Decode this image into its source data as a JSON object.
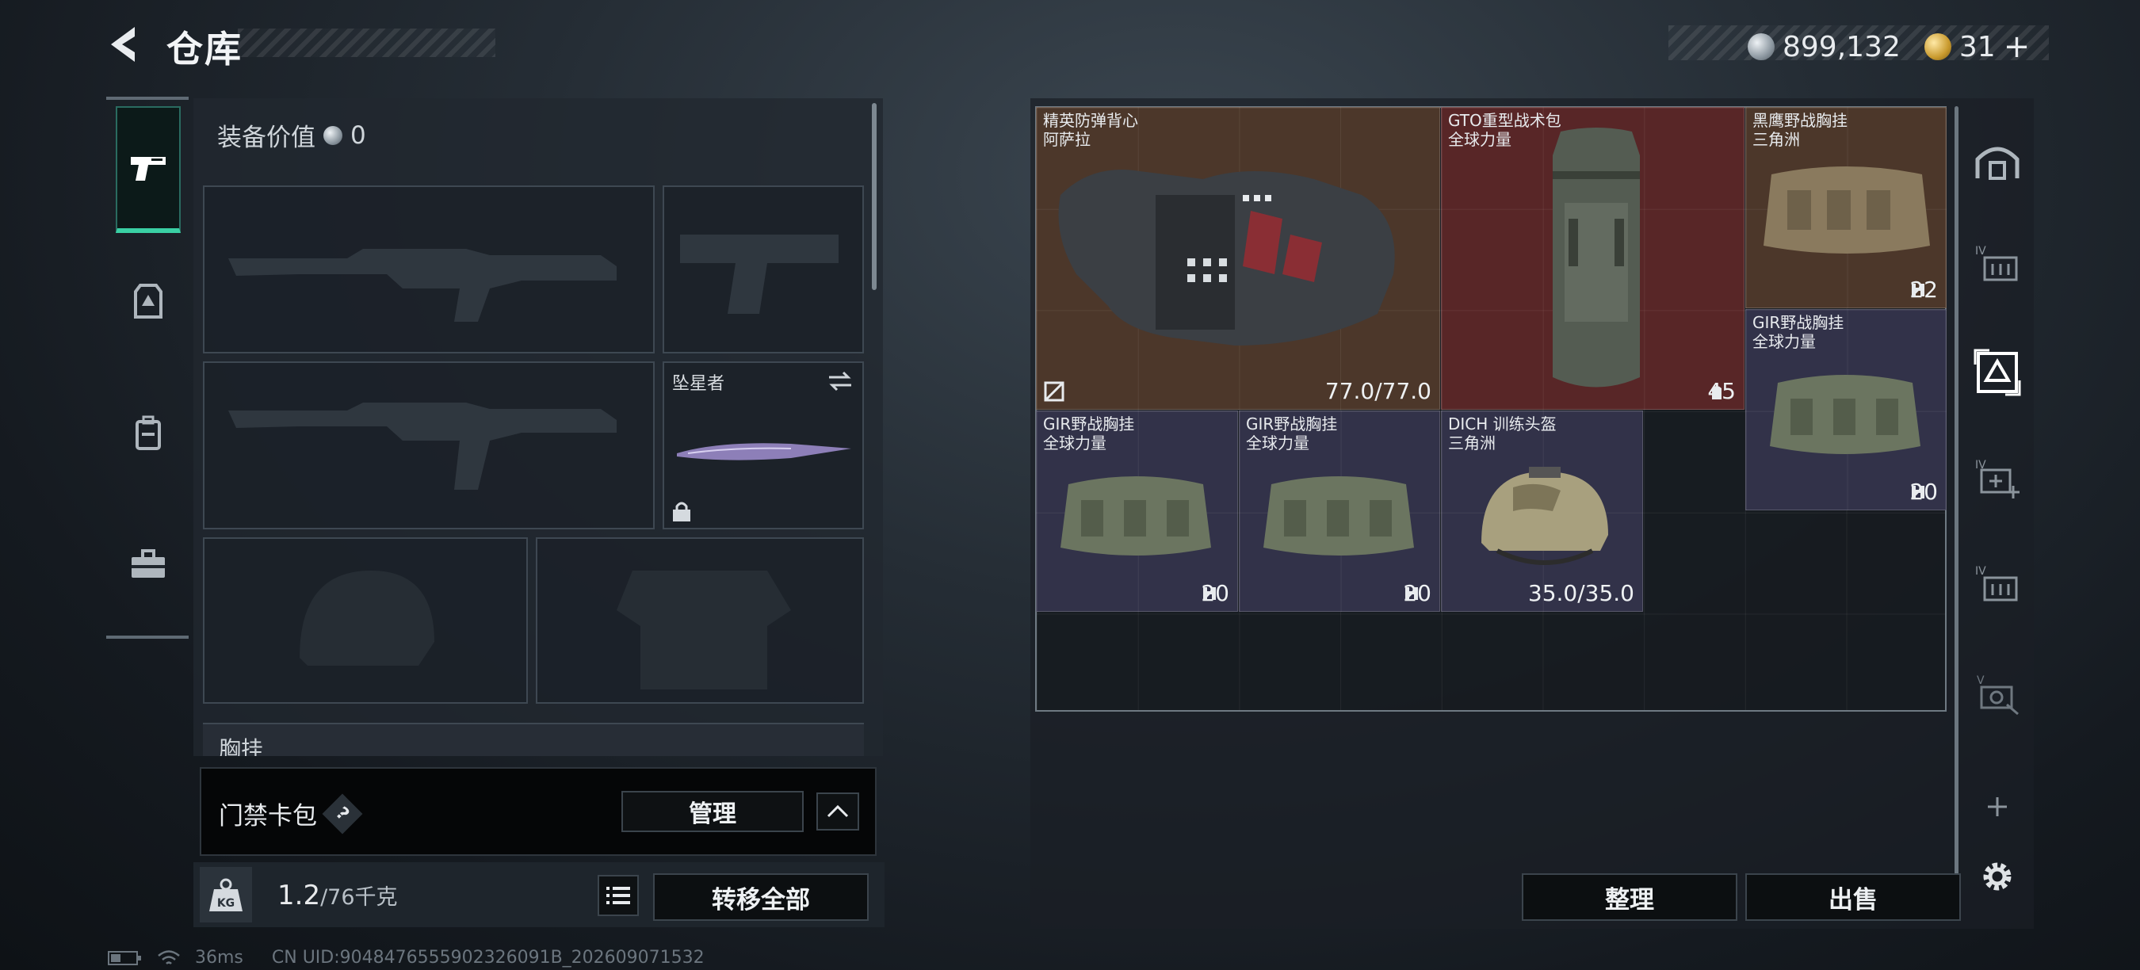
{
  "header": {
    "title": "仓库"
  },
  "currency": {
    "coins": "899,132",
    "tickets": "31",
    "add_symbol": "+"
  },
  "equipment": {
    "value_label": "装备价值",
    "value": "0",
    "melee_slot_name": "坠星者",
    "chest_rig_label": "胸挂"
  },
  "keycard": {
    "label": "门禁卡包",
    "help": "?",
    "manage": "管理"
  },
  "weight": {
    "current": "1.2",
    "max": "/76千克"
  },
  "actions": {
    "transfer_all": "转移全部",
    "sort": "整理",
    "sell": "出售"
  },
  "stash_items": [
    {
      "name": "精英防弹背心",
      "sub": "阿萨拉",
      "stat": "77.0/77.0",
      "rarity": "brown"
    },
    {
      "name": "GTO重型战术包",
      "sub": "全球力量",
      "stat": "45",
      "rarity": "red"
    },
    {
      "name": "黑鹰野战胸挂",
      "sub": "三角洲",
      "stat": "22",
      "rarity": "brown"
    },
    {
      "name": "GIR野战胸挂",
      "sub": "全球力量",
      "stat": "20",
      "rarity": "purple"
    },
    {
      "name": "GIR野战胸挂",
      "sub": "全球力量",
      "stat": "20",
      "rarity": "purple"
    },
    {
      "name": "GIR野战胸挂",
      "sub": "全球力量",
      "stat": "20",
      "rarity": "purple"
    },
    {
      "name": "DICH 训练头盔",
      "sub": "三角洲",
      "stat": "35.0/35.0",
      "rarity": "purple"
    }
  ],
  "status": {
    "ping": "36ms",
    "uid": "CN UID:9048476555902326091B_202609071532"
  },
  "colors": {
    "accent": "#3ad0a4",
    "brown": "#563c2c",
    "red": "#622828",
    "purple": "#37364e"
  },
  "icons": [
    "back-arrow-icon",
    "pistol-icon",
    "armor-icon",
    "backpack-icon",
    "toolbox-icon",
    "lock-icon",
    "swap-icon",
    "chevron-up-icon",
    "kg-weight-icon",
    "list-icon",
    "helmet-icon",
    "add-icon",
    "gear-icon",
    "battery-icon",
    "wifi-icon"
  ]
}
